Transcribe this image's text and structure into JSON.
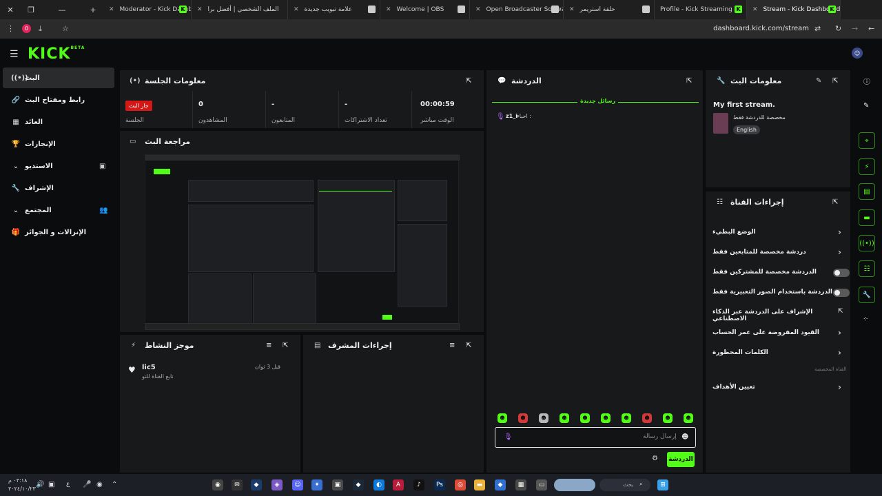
{
  "tabs": [
    {
      "title": "Moderator - Kick Dashbo"
    },
    {
      "title": "الملف الشخصي | أفضل برا"
    },
    {
      "title": "علامة تبويب جديدة"
    },
    {
      "title": "Welcome | OBS"
    },
    {
      "title": "Open Broadcaster Softwa"
    },
    {
      "title": "حلقة استريمر"
    },
    {
      "title": "Profile - Kick Streaming"
    },
    {
      "title": "Stream - Kick Dashboard"
    }
  ],
  "address": {
    "url": "dashboard.kick.com/stream",
    "badge": "0"
  },
  "logo": {
    "text": "KICK",
    "beta": "BETA"
  },
  "sidebar": {
    "items": [
      {
        "label": "البث"
      },
      {
        "label": "رابط ومفتاح البث"
      },
      {
        "label": "العائد"
      },
      {
        "label": "الإنجازات"
      },
      {
        "label": "الاستديو"
      },
      {
        "label": "الإشراف"
      },
      {
        "label": "المجتمع"
      },
      {
        "label": "الإنزالات و الجوائز"
      }
    ]
  },
  "session": {
    "title": "معلومات الجلسة",
    "live_label": "جار البث",
    "session_label": "الجلسة",
    "stats": [
      {
        "value": "0",
        "label": "المشاهدون"
      },
      {
        "value": "-",
        "label": "المتابعون"
      },
      {
        "value": "-",
        "label": "تعداد الاشتراكات"
      },
      {
        "value": "00:00:59",
        "label": "الوقت مباشر"
      }
    ]
  },
  "preview": {
    "title": "مراجعة البث"
  },
  "activity": {
    "title": "موجز النشاط",
    "item": {
      "user": "lic5",
      "action": "تابع القناة للتو",
      "time": "قبل 3 ثوان"
    }
  },
  "modactions": {
    "title": "إجراءات المشرف"
  },
  "chat": {
    "title": "الدردشة",
    "new_messages": "رسائل جديدة",
    "message_user": "z1_i",
    "message_text": "احباء :",
    "input_placeholder": "إرسال رسالة",
    "send_label": "الدردشة"
  },
  "streaminfo": {
    "title": "معلومات البث",
    "stream_title": "My first stream.",
    "category": "مخصصة للدردشة فقط",
    "language": "English"
  },
  "channelactions": {
    "title": "إجراءات القناة",
    "items": [
      {
        "label": "الوضع البطيء",
        "control": "chevron"
      },
      {
        "label": "دردشة مخصصة للمتابعين فقط",
        "control": "chevron"
      },
      {
        "label": "الدردشة مخصصة للمشتركين فقط",
        "control": "toggle"
      },
      {
        "label": "الدردشة باستخدام الصور التعبيرية فقط",
        "control": "toggle"
      },
      {
        "label": "الإشراف على الدردشة عبر الذكاء الاصطناعي",
        "control": "link"
      },
      {
        "label": "القيود المفروضة على عمر الحساب",
        "control": "chevron"
      },
      {
        "label": "الكلمات المحظورة",
        "control": "chevron"
      }
    ],
    "hidden_section": "القناة المخصصة",
    "goals_label": "تعيين الأهداف"
  },
  "taskbar": {
    "search_placeholder": "بحث",
    "time": "٠٣:١٨ م",
    "date": "٢٠٢٤/١٠/٢٣",
    "lang": "ع"
  },
  "colors": {
    "accent": "#53fc18",
    "panel": "#18191b",
    "bg": "#0b0c0d",
    "live": "#d31818"
  }
}
